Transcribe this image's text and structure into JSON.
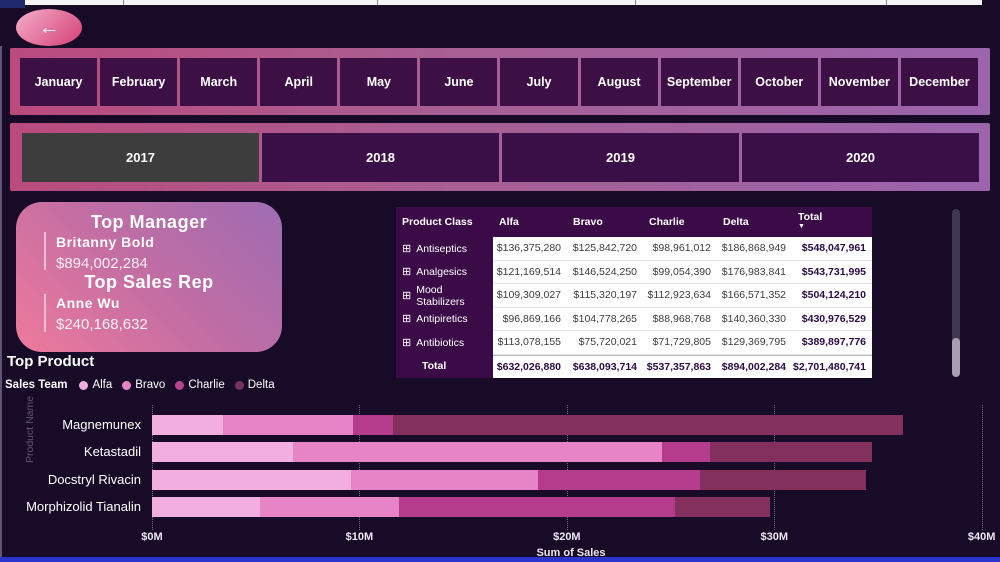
{
  "back_button": {
    "icon": "←"
  },
  "months": [
    "January",
    "February",
    "March",
    "April",
    "May",
    "June",
    "July",
    "August",
    "September",
    "October",
    "November",
    "December"
  ],
  "years": [
    "2017",
    "2018",
    "2019",
    "2020"
  ],
  "selected_year": "2017",
  "card": {
    "title1": "Top Manager",
    "manager_name": "Britanny Bold",
    "manager_value": "$894,002,284",
    "title2": "Top Sales Rep",
    "rep_name": "Anne Wu",
    "rep_value": "$240,168,632"
  },
  "top_product_label": "Top Product",
  "legend": {
    "title": "Sales Team",
    "items": [
      {
        "name": "Alfa",
        "color": "#f2aede"
      },
      {
        "name": "Bravo",
        "color": "#e784c6"
      },
      {
        "name": "Charlie",
        "color": "#b7458e"
      },
      {
        "name": "Delta",
        "color": "#743260"
      }
    ]
  },
  "table": {
    "header": [
      "Product Class",
      "Alfa",
      "Bravo",
      "Charlie",
      "Delta",
      "Total"
    ],
    "sort_column": "Total",
    "sort_icon": "▼",
    "expand_icon": "⊞",
    "rows": [
      {
        "label": "Antiseptics",
        "values": [
          "$136,375,280",
          "$125,842,720",
          "$98,961,012",
          "$186,868,949",
          "$548,047,961"
        ]
      },
      {
        "label": "Analgesics",
        "values": [
          "$121,169,514",
          "$146,524,250",
          "$99,054,390",
          "$176,983,841",
          "$543,731,995"
        ]
      },
      {
        "label": "Mood Stabilizers",
        "values": [
          "$109,309,027",
          "$115,320,197",
          "$112,923,634",
          "$166,571,352",
          "$504,124,210"
        ]
      },
      {
        "label": "Antipiretics",
        "values": [
          "$96,869,166",
          "$104,778,265",
          "$88,968,768",
          "$140,360,330",
          "$430,976,529"
        ]
      },
      {
        "label": "Antibiotics",
        "values": [
          "$113,078,155",
          "$75,720,021",
          "$71,729,805",
          "$129,369,795",
          "$389,897,776"
        ]
      }
    ],
    "total_row": {
      "label": "Total",
      "values": [
        "$632,026,880",
        "$638,093,714",
        "$537,357,863",
        "$894,002,284",
        "$2,701,480,741"
      ]
    }
  },
  "chart_data": {
    "type": "bar",
    "orientation": "horizontal",
    "stacked": true,
    "title": "Top Product",
    "xlabel": "Sum of Sales",
    "ylabel": "Product Name",
    "xlim": [
      0,
      40.4
    ],
    "x_tick_values": [
      0,
      10,
      20,
      30,
      40
    ],
    "x_tick_labels": [
      "$0M",
      "$10M",
      "$20M",
      "$30M",
      "$40M"
    ],
    "unit": "millions USD",
    "grid": "dotted-vertical",
    "legend_position": "top-left",
    "categories": [
      "Magnemunex",
      "Ketastadil",
      "Docstryl Rivacin",
      "Morphizolid Tianalin"
    ],
    "series": [
      {
        "name": "Alfa",
        "color": "#f2aede",
        "values": [
          3.4,
          6.8,
          9.6,
          5.2
        ]
      },
      {
        "name": "Bravo",
        "color": "#e784c6",
        "values": [
          6.3,
          17.8,
          9.0,
          6.7
        ]
      },
      {
        "name": "Charlie",
        "color": "#b53b8c",
        "values": [
          1.9,
          2.3,
          7.8,
          13.3
        ]
      },
      {
        "name": "Delta",
        "color": "#83305f",
        "values": [
          24.6,
          7.8,
          8.0,
          4.6
        ]
      }
    ]
  },
  "colors": {
    "page_bg": "#170b27",
    "strip_gradient_left": "#bb4a7d",
    "strip_gradient_right": "#9b64ad",
    "slicer_button_bg": "#3c1044",
    "selected_year_bg": "#3c3d3c",
    "card_gradient_top": "#9e6cb2",
    "card_gradient_bottom": "#ee7a9b",
    "table_header_bg": "#3a0b47",
    "accent_blue": "#2b34cc"
  },
  "ruler_tick_positions": [
    5,
    123,
    377,
    635,
    886
  ]
}
